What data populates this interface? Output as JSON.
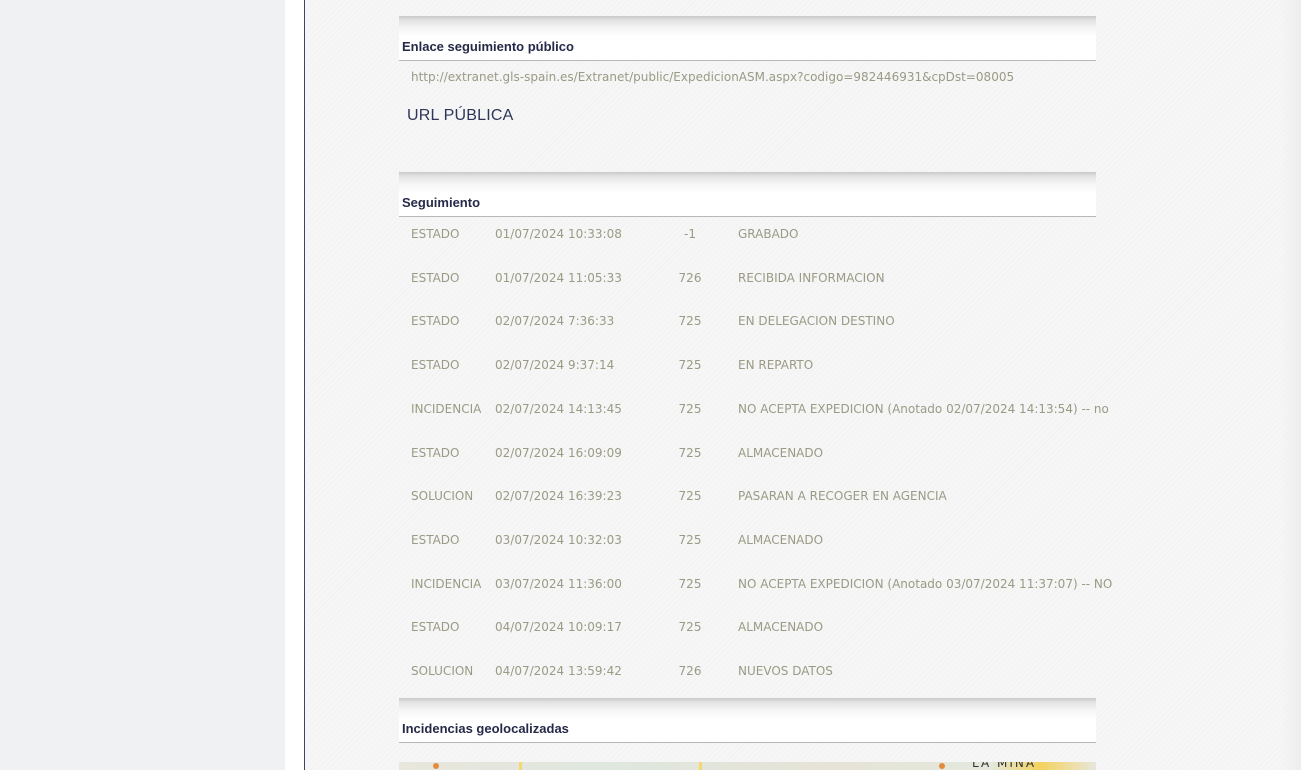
{
  "public_link": {
    "title": "Enlace seguimiento público",
    "url": "http://extranet.gls-spain.es/Extranet/public/ExpedicionASM.aspx?codigo=982446931&cpDst=08005",
    "url_label": "URL PÚBLICA"
  },
  "tracking": {
    "title": "Seguimiento",
    "rows": [
      {
        "type": "ESTADO",
        "date": "01/07/2024 10:33:08",
        "code": "-1",
        "description": "GRABADO"
      },
      {
        "type": "ESTADO",
        "date": "01/07/2024 11:05:33",
        "code": "726",
        "description": "RECIBIDA INFORMACION"
      },
      {
        "type": "ESTADO",
        "date": "02/07/2024 7:36:33",
        "code": "725",
        "description": "EN DELEGACION DESTINO"
      },
      {
        "type": "ESTADO",
        "date": "02/07/2024 9:37:14",
        "code": "725",
        "description": "EN REPARTO"
      },
      {
        "type": "INCIDENCIA",
        "date": "02/07/2024 14:13:45",
        "code": "725",
        "description": "NO ACEPTA EXPEDICION (Anotado 02/07/2024 14:13:54) -- no"
      },
      {
        "type": "ESTADO",
        "date": "02/07/2024 16:09:09",
        "code": "725",
        "description": "ALMACENADO"
      },
      {
        "type": "SOLUCION",
        "date": "02/07/2024 16:39:23",
        "code": "725",
        "description": "PASARAN A RECOGER EN AGENCIA"
      },
      {
        "type": "ESTADO",
        "date": "03/07/2024 10:32:03",
        "code": "725",
        "description": "ALMACENADO"
      },
      {
        "type": "INCIDENCIA",
        "date": "03/07/2024 11:36:00",
        "code": "725",
        "description": "NO ACEPTA EXPEDICION (Anotado 03/07/2024 11:37:07) -- NO"
      },
      {
        "type": "ESTADO",
        "date": "04/07/2024 10:09:17",
        "code": "725",
        "description": "ALMACENADO"
      },
      {
        "type": "SOLUCION",
        "date": "04/07/2024 13:59:42",
        "code": "726",
        "description": "NUEVOS DATOS"
      }
    ]
  },
  "geo_incidents": {
    "title": "Incidencias geolocalizadas",
    "map_label": "LA MINA"
  },
  "colors": {
    "heading": "#252a48",
    "row_text": "#9a9a85",
    "url_label": "#2e3559"
  }
}
